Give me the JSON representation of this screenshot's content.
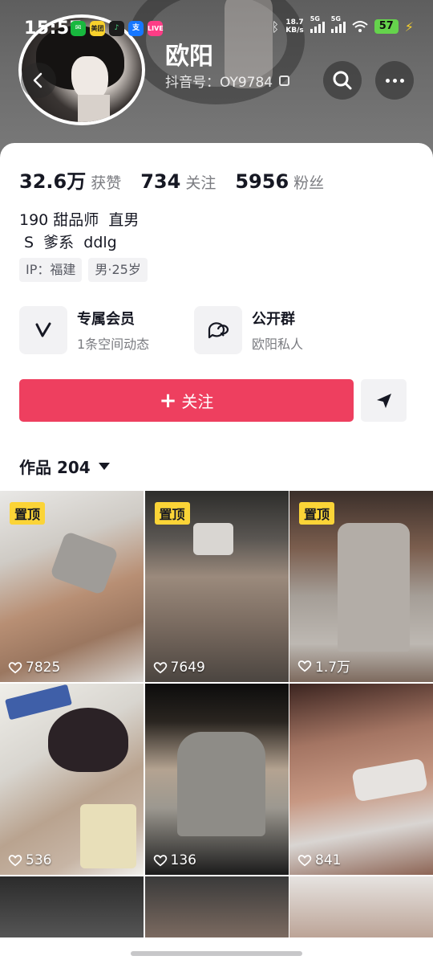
{
  "status_bar": {
    "time": "15:57",
    "apps": [
      "wechat-icon",
      "meituan-icon",
      "music-icon",
      "alipay-icon",
      "live-icon"
    ],
    "meituan_text": "美团",
    "alipay_text": "支",
    "live_text": "LIVE",
    "net_speed_value": "18.7",
    "net_speed_unit": "KB/s",
    "signal1_label": "5G",
    "signal2_label": "5G",
    "battery": "57"
  },
  "header": {
    "name": "欧阳",
    "douyin_id": "抖音号：OY9784"
  },
  "stats": {
    "likes_num": "32.6万",
    "likes_label": "获赞",
    "following_num": "734",
    "following_label": "关注",
    "followers_num": "5956",
    "followers_label": "粉丝"
  },
  "bio": {
    "line1": "190 甜品师  直男",
    "line2": " S  爹系  ddlg"
  },
  "tags": [
    "IP：福建",
    "男·25岁"
  ],
  "features": [
    {
      "title": "专属会员",
      "sub": "1条空间动态"
    },
    {
      "title": "公开群",
      "sub": "欧阳私人"
    }
  ],
  "follow_label": "关注",
  "works": {
    "label": "作品 204"
  },
  "pin_label": "置顶",
  "posts": [
    {
      "likes": "7825",
      "pinned": true
    },
    {
      "likes": "7649",
      "pinned": true
    },
    {
      "likes": "1.7万",
      "pinned": true
    },
    {
      "likes": "536",
      "pinned": false
    },
    {
      "likes": "136",
      "pinned": false
    },
    {
      "likes": "841",
      "pinned": false
    }
  ],
  "colors": {
    "follow_button": "#ee3f5f",
    "pin_badge": "#fbd437",
    "text_primary": "#161823",
    "text_secondary": "#7a7b80"
  }
}
